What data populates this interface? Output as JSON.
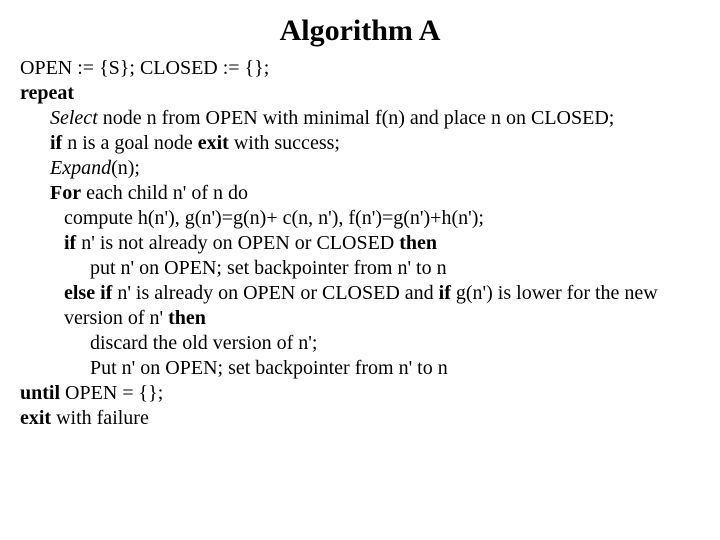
{
  "title": "Algorithm A",
  "l1_a": "OPEN := {S}; CLOSED := {};",
  "l2_a": "repeat",
  "l3_a": "Select",
  "l3_b": " node n from OPEN with minimal f(n) and place n on CLOSED;",
  "l4_a": "if",
  "l4_b": " n is a goal node ",
  "l4_c": "exit",
  "l4_d": " with success;",
  "l5_a": "Expand",
  "l5_b": "(n);",
  "l6_a": "For",
  "l6_b": " each child n' of n do",
  "l7_a": "compute h(n'),  g(n')=g(n)+ c(n, n'),  f(n')=g(n')+h(n');",
  "l8_a": "if",
  "l8_b": " n' is not already on OPEN or CLOSED ",
  "l8_c": "then",
  "l9_a": "put n' on OPEN; set backpointer from n' to n",
  "l10_a": "else if",
  "l10_b": " n' is already on OPEN or CLOSED and ",
  "l10_c": "if",
  "l10_d": " g(n') is lower for the new version of n' ",
  "l10_e": "then",
  "l11_a": "discard the old version of n';",
  "l12_a": "Put n' on OPEN; set backpointer from n' to n",
  "l13_a": "until",
  "l13_b": " OPEN = {};",
  "l14_a": "exit",
  "l14_b": " with failure"
}
